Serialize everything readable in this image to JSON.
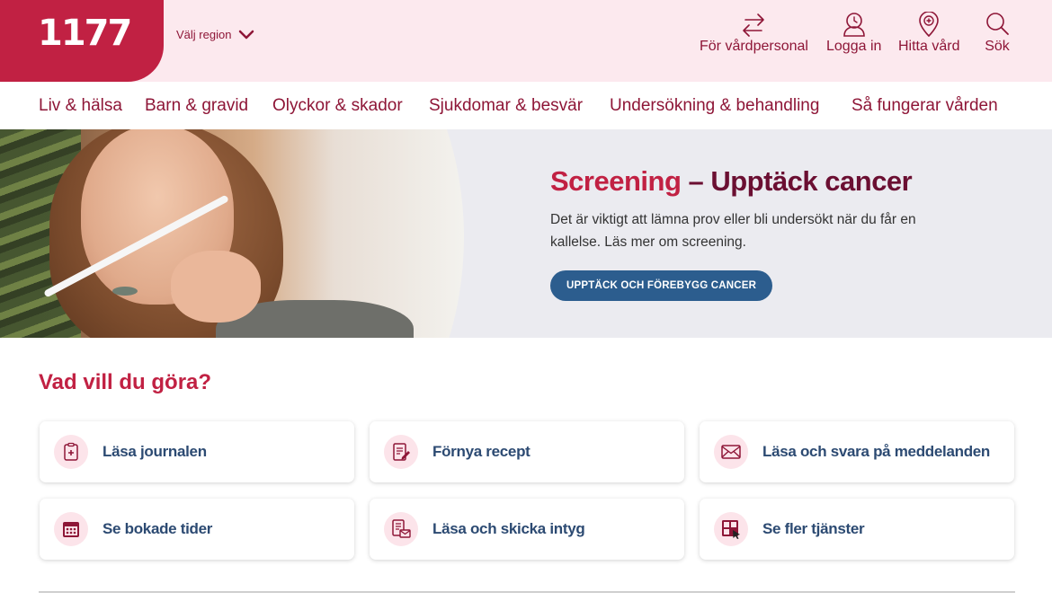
{
  "header": {
    "logo": "1177",
    "region_label": "Välj region",
    "links": [
      {
        "label": "För vårdpersonal",
        "icon": "arrows-icon"
      },
      {
        "label": "Logga in",
        "icon": "user-icon"
      },
      {
        "label": "Hitta vård",
        "icon": "location-icon"
      },
      {
        "label": "Sök",
        "icon": "search-icon"
      }
    ]
  },
  "nav": {
    "items": [
      "Liv & hälsa",
      "Barn & gravid",
      "Olyckor & skador",
      "Sjukdomar & besvär",
      "Undersökning & behandling",
      "Så fungerar vården"
    ]
  },
  "hero": {
    "title_part1": "Screening",
    "title_part2": " – Upptäck cancer",
    "text": "Det är viktigt att lämna prov eller bli undersökt när du får en kallelse. Läs mer om screening.",
    "button": "UPPTÄCK OCH FÖREBYGG CANCER"
  },
  "services": {
    "title": "Vad vill du göra?",
    "items": [
      {
        "label": "Läsa journalen",
        "icon": "journal-icon"
      },
      {
        "label": "Förnya recept",
        "icon": "prescription-icon"
      },
      {
        "label": "Läsa och svara på meddelanden",
        "icon": "mail-icon"
      },
      {
        "label": "Se bokade tider",
        "icon": "calendar-icon"
      },
      {
        "label": "Läsa och skicka intyg",
        "icon": "certificate-icon"
      },
      {
        "label": "Se fler tjänster",
        "icon": "grid-icon"
      }
    ]
  },
  "colors": {
    "brand_red": "#c12143",
    "dark_red": "#8e1637",
    "header_bg": "#fce9ee",
    "button_blue": "#2c5d8e",
    "card_text": "#2c4a72"
  }
}
